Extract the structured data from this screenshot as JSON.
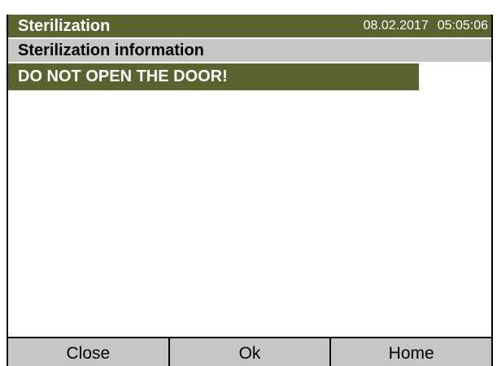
{
  "header": {
    "title": "Sterilization",
    "date": "08.02.2017",
    "time": "05:05:06"
  },
  "subheader": {
    "label": "Sterilization information"
  },
  "warning": {
    "message": "DO NOT OPEN THE DOOR!"
  },
  "footer": {
    "buttons": [
      "Close",
      "Ok",
      "Home"
    ]
  },
  "colors": {
    "header_bg": "#58632f",
    "subheader_bg": "#c6c6c6",
    "warning_bg": "#58632f",
    "button_bg": "#c6c6c6"
  }
}
